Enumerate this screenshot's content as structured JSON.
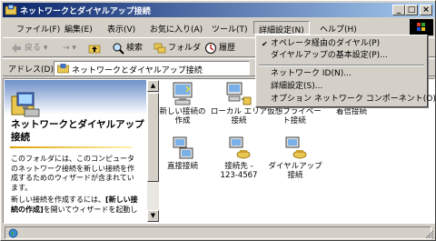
{
  "window": {
    "title": "ネットワークとダイヤルアップ接続",
    "minimize": "_",
    "maximize": "□",
    "close": "×"
  },
  "menu": {
    "items": [
      "ファイル(F)",
      "編集(E)",
      "表示(V)",
      "お気に入り(A)",
      "ツール(T)",
      "詳細設定(N)",
      "ヘルプ(H)"
    ],
    "active_index": 5
  },
  "toolbar": {
    "back": "戻る",
    "forward_arrow": "→",
    "search": "検索",
    "folders": "フォルダ",
    "history": "履歴"
  },
  "address": {
    "label": "アドレス(D)",
    "value": "ネットワークとダイヤルアップ接続"
  },
  "dropdown": {
    "items": [
      {
        "label": "オペレータ経由のダイヤル(P)",
        "checked": true
      },
      {
        "label": "ダイヤルアップの基本設定(P)...",
        "checked": false
      },
      {
        "label": "ネットワーク ID(N)...",
        "checked": false
      },
      {
        "label": "詳細設定(S)...",
        "checked": false
      },
      {
        "label": "オプション ネットワーク コンポーネント(O)...",
        "checked": false
      }
    ],
    "check_glyph": "✔"
  },
  "leftpanel": {
    "title": "ネットワークとダイヤルアップ接続",
    "text1": "このフォルダには、このコンピュータのネットワーク接続を新しい接続を作成するためのウィザードが含まれています。",
    "text2_prefix": "新しい接続を作成するには、",
    "text2_bold": "[新しい接続の作成]",
    "text2_suffix": "を開いてウィザードを起動し"
  },
  "files": [
    {
      "label": "新しい接続の\n作成",
      "icon": "new-connection-icon"
    },
    {
      "label": "ローカル エリア\n接続",
      "icon": "local-area-connection-icon"
    },
    {
      "label": "仮想プライベー\nト接続",
      "icon": "vpn-connection-icon"
    },
    {
      "label": "着信接続",
      "icon": "incoming-connection-icon"
    },
    {
      "label": "直接接続",
      "icon": "direct-connection-icon"
    },
    {
      "label": "接続先 -\n123-4567",
      "icon": "dialup-connection-icon"
    },
    {
      "label": "ダイヤルアップ\n接続",
      "icon": "dialup-connection-icon"
    }
  ],
  "scrollbar": {
    "up": "▲",
    "down": "▼"
  }
}
